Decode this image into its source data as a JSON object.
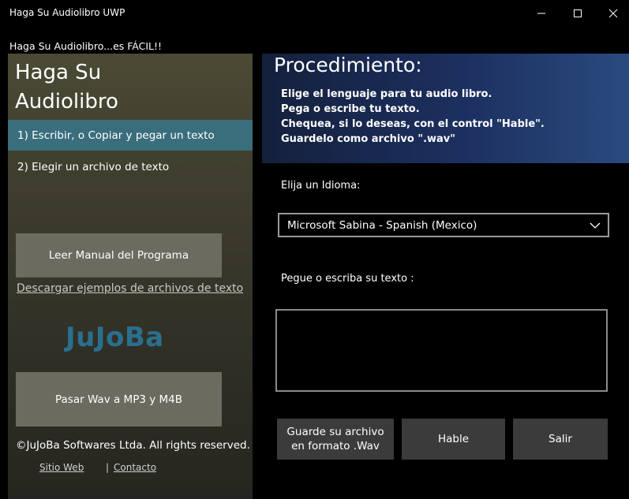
{
  "window": {
    "title": "Haga Su Audiolibro UWP",
    "minimize_icon": "minimize-icon",
    "maximize_icon": "maximize-icon",
    "close_icon": "close-icon"
  },
  "header": {
    "subtitle": "Haga Su Audiolibro...es FÁCIL!!"
  },
  "sidebar": {
    "title_line1": "Haga Su",
    "title_line2": "Audiolibro",
    "items": [
      {
        "label": "1) Escribir, o Copiar y pegar un texto",
        "selected": true
      },
      {
        "label": "2) Elegir un archivo de texto",
        "selected": false
      }
    ],
    "manual_button": "Leer Manual del Programa",
    "download_link": "Descargar ejemplos de archivos de texto",
    "logo_text": "JuJoBa",
    "wav_button": "Pasar Wav a MP3 y M4B",
    "copyright": "©JuJoBa Softwares Ltda. All rights reserved.",
    "footer_links": [
      "Sitio Web",
      "Contacto"
    ],
    "footer_separator": "|"
  },
  "banner": {
    "title": "Procedimiento:",
    "steps": [
      "Elige el lenguaje para tu audio libro.",
      "Pega o escribe tu texto.",
      "Chequea, si lo deseas, con el control  \"Hable\".",
      "Guardelo como archivo \".wav\""
    ]
  },
  "main": {
    "language_label": "Elija un Idioma:",
    "language_selected": "Microsoft Sabina - Spanish (Mexico)",
    "text_label": "Pegue o escriba su texto :",
    "text_value": "",
    "buttons": {
      "save_line1": "Guarde su archivo",
      "save_line2": "en formato .Wav",
      "speak": "Hable",
      "exit": "Salir"
    }
  },
  "colors": {
    "selected_item": "#3a6e7c",
    "logo": "#2a6f8e",
    "sidebar_button": "#6b6b5f",
    "main_button": "#3b3b3b"
  }
}
